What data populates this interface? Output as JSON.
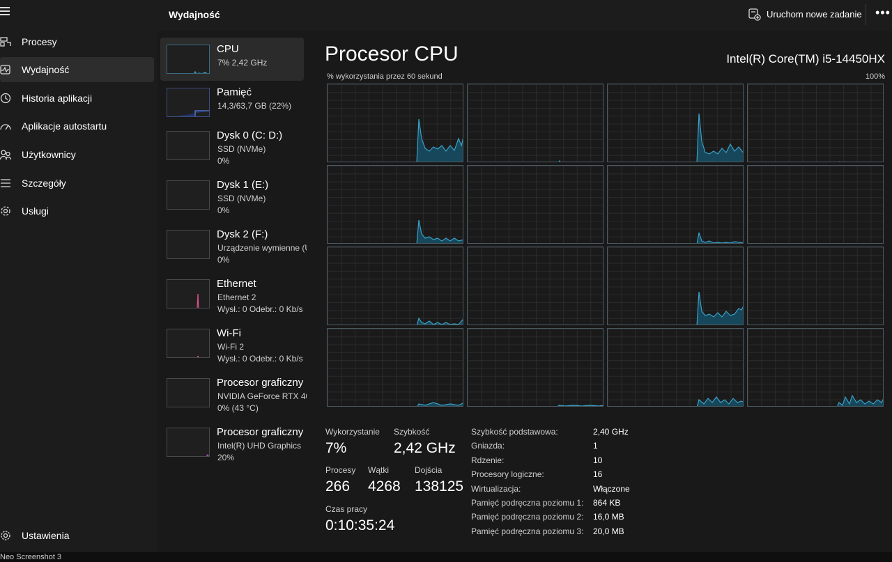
{
  "header": {
    "title": "Wydajność",
    "run_task_label": "Uruchom nowe zadanie",
    "more_label": "•••"
  },
  "nav": {
    "items": [
      {
        "label": "Procesy",
        "icon": "processes-icon"
      },
      {
        "label": "Wydajność",
        "icon": "performance-icon"
      },
      {
        "label": "Historia aplikacji",
        "icon": "history-icon"
      },
      {
        "label": "Aplikacje autostartu",
        "icon": "startup-icon"
      },
      {
        "label": "Użytkownicy",
        "icon": "users-icon"
      },
      {
        "label": "Szczegóły",
        "icon": "details-icon"
      },
      {
        "label": "Usługi",
        "icon": "services-icon"
      }
    ],
    "settings_label": "Ustawienia"
  },
  "devices": [
    {
      "name": "CPU",
      "lines": [
        "7%  2,42 GHz"
      ],
      "color": "#3aa0c8"
    },
    {
      "name": "Pamięć",
      "lines": [
        "14,3/63,7 GB (22%)"
      ],
      "color": "#5b7cd9",
      "fill": 0.22
    },
    {
      "name": "Dysk 0 (C: D:)",
      "lines": [
        "SSD (NVMe)",
        "0%"
      ],
      "color": "#5aa05a"
    },
    {
      "name": "Dysk 1 (E:)",
      "lines": [
        "SSD (NVMe)",
        "0%"
      ],
      "color": "#5aa05a"
    },
    {
      "name": "Dysk 2 (F:)",
      "lines": [
        "Urządzenie wymienne (U",
        "0%"
      ],
      "color": "#5aa05a"
    },
    {
      "name": "Ethernet",
      "lines": [
        "Ethernet 2",
        "Wysł.: 0  Odebr.: 0 Kb/s"
      ],
      "color": "#d0508a"
    },
    {
      "name": "Wi-Fi",
      "lines": [
        "Wi-Fi 2",
        "Wysł.: 0  Odebr.: 0 Kb/s"
      ],
      "color": "#d0508a"
    },
    {
      "name": "Procesor graficzny",
      "lines": [
        "NVIDIA GeForce RTX 40",
        "0% (43 °C)"
      ],
      "color": "#a05ad0"
    },
    {
      "name": "Procesor graficzny",
      "lines": [
        "Intel(R) UHD Graphics",
        "20%"
      ],
      "color": "#a05ad0"
    }
  ],
  "main": {
    "title": "Procesor CPU",
    "cpu_model": "Intel(R) Core(TM) i5-14450HX",
    "graph_caption": "% wykorzystania przez 60 sekund",
    "graph_max": "100%"
  },
  "stats": {
    "utilization_label": "Wykorzystanie",
    "utilization": "7%",
    "speed_label": "Szybkość",
    "speed": "2,42 GHz",
    "processes_label": "Procesy",
    "processes": "266",
    "threads_label": "Wątki",
    "threads": "4268",
    "handles_label": "Dojścia",
    "handles": "138125",
    "uptime_label": "Czas pracy",
    "uptime": "0:10:35:24"
  },
  "details": [
    {
      "k": "Szybkość podstawowa:",
      "v": "2,40 GHz"
    },
    {
      "k": "Gniazda:",
      "v": "1"
    },
    {
      "k": "Rdzenie:",
      "v": "10"
    },
    {
      "k": "Procesory logiczne:",
      "v": "16"
    },
    {
      "k": "Wirtualizacja:",
      "v": "Włączone"
    },
    {
      "k": "Pamięć podręczna poziomu 1:",
      "v": "864 KB"
    },
    {
      "k": "Pamięć podręczna poziomu 2:",
      "v": "16,0 MB"
    },
    {
      "k": "Pamięć podręczna poziomu 3:",
      "v": "20,0 MB"
    }
  ],
  "colors": {
    "accent": "#3aa0c8",
    "graph_fill": "#17475a",
    "background": "#191919"
  },
  "bottom_caption": "Neo  Screenshot 3"
}
